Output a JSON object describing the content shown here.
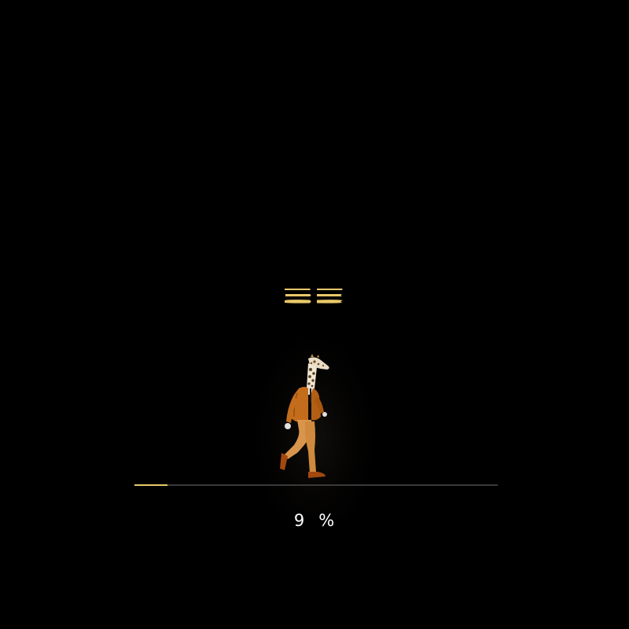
{
  "loader": {
    "progress_value": "9",
    "progress_unit": "%",
    "progress_fraction": 0.09
  },
  "colors": {
    "background": "#000000",
    "accent": "#e8c86a",
    "track": "#3a3a3a",
    "text": "#ffffff"
  },
  "icons": {
    "logo": "double-chevron-logo-icon",
    "figure": "giraffe-man-walking-illustration"
  }
}
